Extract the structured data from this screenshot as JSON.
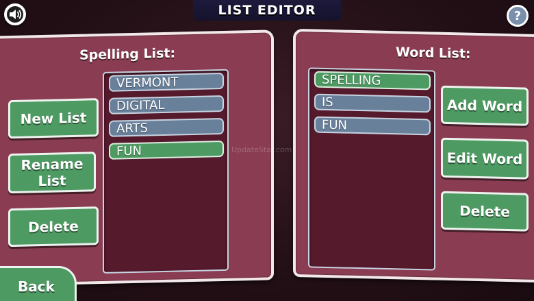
{
  "header": {
    "title": "LIST EDITOR"
  },
  "icons": {
    "sound": "speaker-icon",
    "help": "help-icon"
  },
  "help_label": "?",
  "spelling_panel": {
    "title": "Spelling List:",
    "items": [
      "VERMONT",
      "DIGITAL",
      "ARTS",
      "FUN"
    ],
    "selected": "FUN",
    "buttons": {
      "new_list": "New List",
      "rename_list": "Rename\nList",
      "delete": "Delete"
    }
  },
  "word_panel": {
    "title": "Word List:",
    "items": [
      "SPELLING",
      "IS",
      "FUN"
    ],
    "selected": "SPELLING",
    "buttons": {
      "add_word": "Add Word",
      "edit_word": "Edit Word",
      "delete": "Delete"
    }
  },
  "footer": {
    "back_label": "Back"
  },
  "watermark": "UpdateStar.com",
  "colors": {
    "panel": "#8a3d52",
    "list_bg": "#561a2d",
    "item": "#69809b",
    "selected_item": "#4e9a63",
    "button": "#4e9a63"
  }
}
